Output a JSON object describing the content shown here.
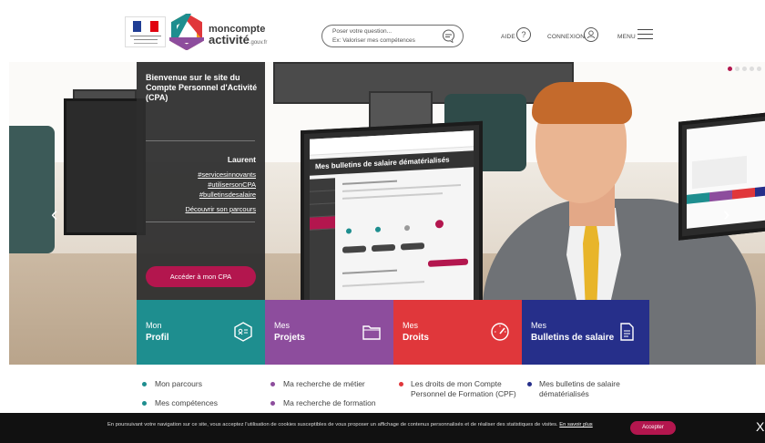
{
  "header": {
    "brand_line1": "moncompte",
    "brand_line2": "activité",
    "brand_domain": ".gouv.fr",
    "search_placeholder_1": "Poser votre question...",
    "search_placeholder_2": "Ex: Valoriser mes compétences",
    "aide_label": "AIDE",
    "connexion_label": "CONNEXION",
    "menu_label": "MENU"
  },
  "hero": {
    "title": "Bienvenue sur le site du Compte Personnel d'Activité (CPA)",
    "name": "Laurent",
    "tags": [
      "#servicesinnovants",
      "#utilisersonCPA",
      "#bulletinsdesalaire"
    ],
    "discover_link": "Découvrir son parcours",
    "cta_label": "Accéder à mon CPA",
    "screen_title": "Mes bulletins de salaire dématérialisés"
  },
  "tiles": [
    {
      "top": "Mon",
      "bottom": "Profil",
      "color": "#1e8e8f"
    },
    {
      "top": "Mes",
      "bottom": "Projets",
      "color": "#8d4d9d"
    },
    {
      "top": "Mes",
      "bottom": "Droits",
      "color": "#e0373b"
    },
    {
      "top": "Mes",
      "bottom": "Bulletins de salaire",
      "color": "#262f8a"
    }
  ],
  "sublinks": {
    "col1": [
      "Mon parcours",
      "Mes compétences"
    ],
    "col2": [
      "Ma recherche de métier",
      "Ma recherche de formation"
    ],
    "col3": [
      "Les droits de mon Compte Personnel de Formation (CPF)"
    ],
    "col4": [
      "Mes bulletins de salaire dématérialisés"
    ]
  },
  "cookie": {
    "text": "En poursuivant votre navigation sur ce site, vous acceptez l'utilisation de cookies susceptibles de vous proposer un affichage de contenus personnalisés et de réaliser des statistiques de visites.",
    "more_link": "En savoir plus",
    "accept_label": "Accepter",
    "close": "X"
  }
}
